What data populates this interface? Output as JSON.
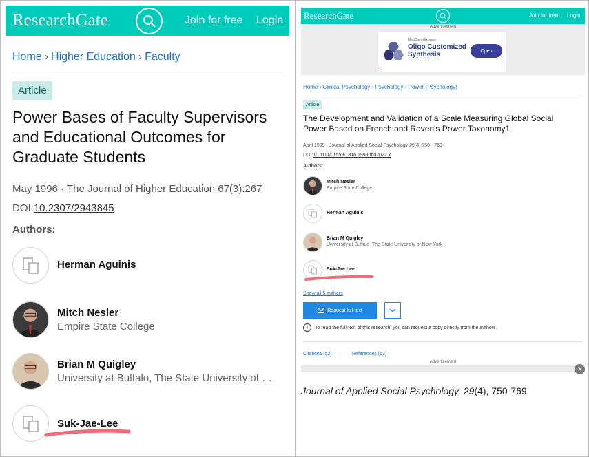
{
  "left": {
    "header": {
      "logo": "ResearchGate",
      "join": "Join for free",
      "login": "Login"
    },
    "breadcrumb": [
      "Home",
      "Higher Education",
      "Faculty"
    ],
    "badge": "Article",
    "title": "Power Bases of Faculty Supervisors and Educational Outcomes for Graduate Students",
    "meta": "May 1996 · The Journal of Higher Education 67(3):267",
    "doi_prefix": "DOI:",
    "doi": "10.2307/2943845",
    "authors_label": "Authors:",
    "authors": [
      {
        "name": "Herman Aguinis",
        "affiliation": ""
      },
      {
        "name": "Mitch Nesler",
        "affiliation": "Empire State College"
      },
      {
        "name": "Brian M Quigley",
        "affiliation": "University at Buffalo, The State University of New York"
      },
      {
        "name": "Suk-Jae-Lee",
        "affiliation": ""
      }
    ],
    "highlight_color": "#f26b7a"
  },
  "right": {
    "header": {
      "logo": "ResearchGate",
      "join": "Join for free",
      "login": "Login"
    },
    "ad": {
      "label": "Advertisement",
      "brand": "MedChemExpress",
      "title": "Oligo Customized Synthesis",
      "button": "Open"
    },
    "breadcrumb": [
      "Home",
      "Clinical Psychology",
      "Psychology",
      "Power (Psychology)"
    ],
    "badge": "Article",
    "title": "The Development and Validation of a Scale Measuring Global Social Power Based on French and Raven's Power Taxonomy1",
    "meta": "April 1999 · Journal of Applied Social Psychology 29(4):750 - 769",
    "doi_prefix": "DOI:",
    "doi": "10.1111/j.1559-1816.1999.tb02022.x",
    "authors_label": "Authors:",
    "authors": [
      {
        "name": "Mitch Nesler",
        "affiliation": "Empire State College"
      },
      {
        "name": "Herman Aguinis",
        "affiliation": ""
      },
      {
        "name": "Brian M Quigley",
        "affiliation": "University at Buffalo, The State University of New York"
      },
      {
        "name": "Suk-Jae Lee",
        "affiliation": ""
      }
    ],
    "show_all": "Show all 5 authors",
    "request_button": "Request full-text",
    "info": "To read the full-text of this research, you can request a copy directly from the authors.",
    "tabs": [
      "Citations (52)",
      "References (63)"
    ],
    "ad_label2": "Advertisement"
  },
  "caption": {
    "journal": "Journal of Applied Social Psychology",
    "volume": "29",
    "rest": "(4), 750-769."
  },
  "colors": {
    "brand": "#00ccbb",
    "link": "#1a73c4",
    "button": "#1e88e5"
  }
}
